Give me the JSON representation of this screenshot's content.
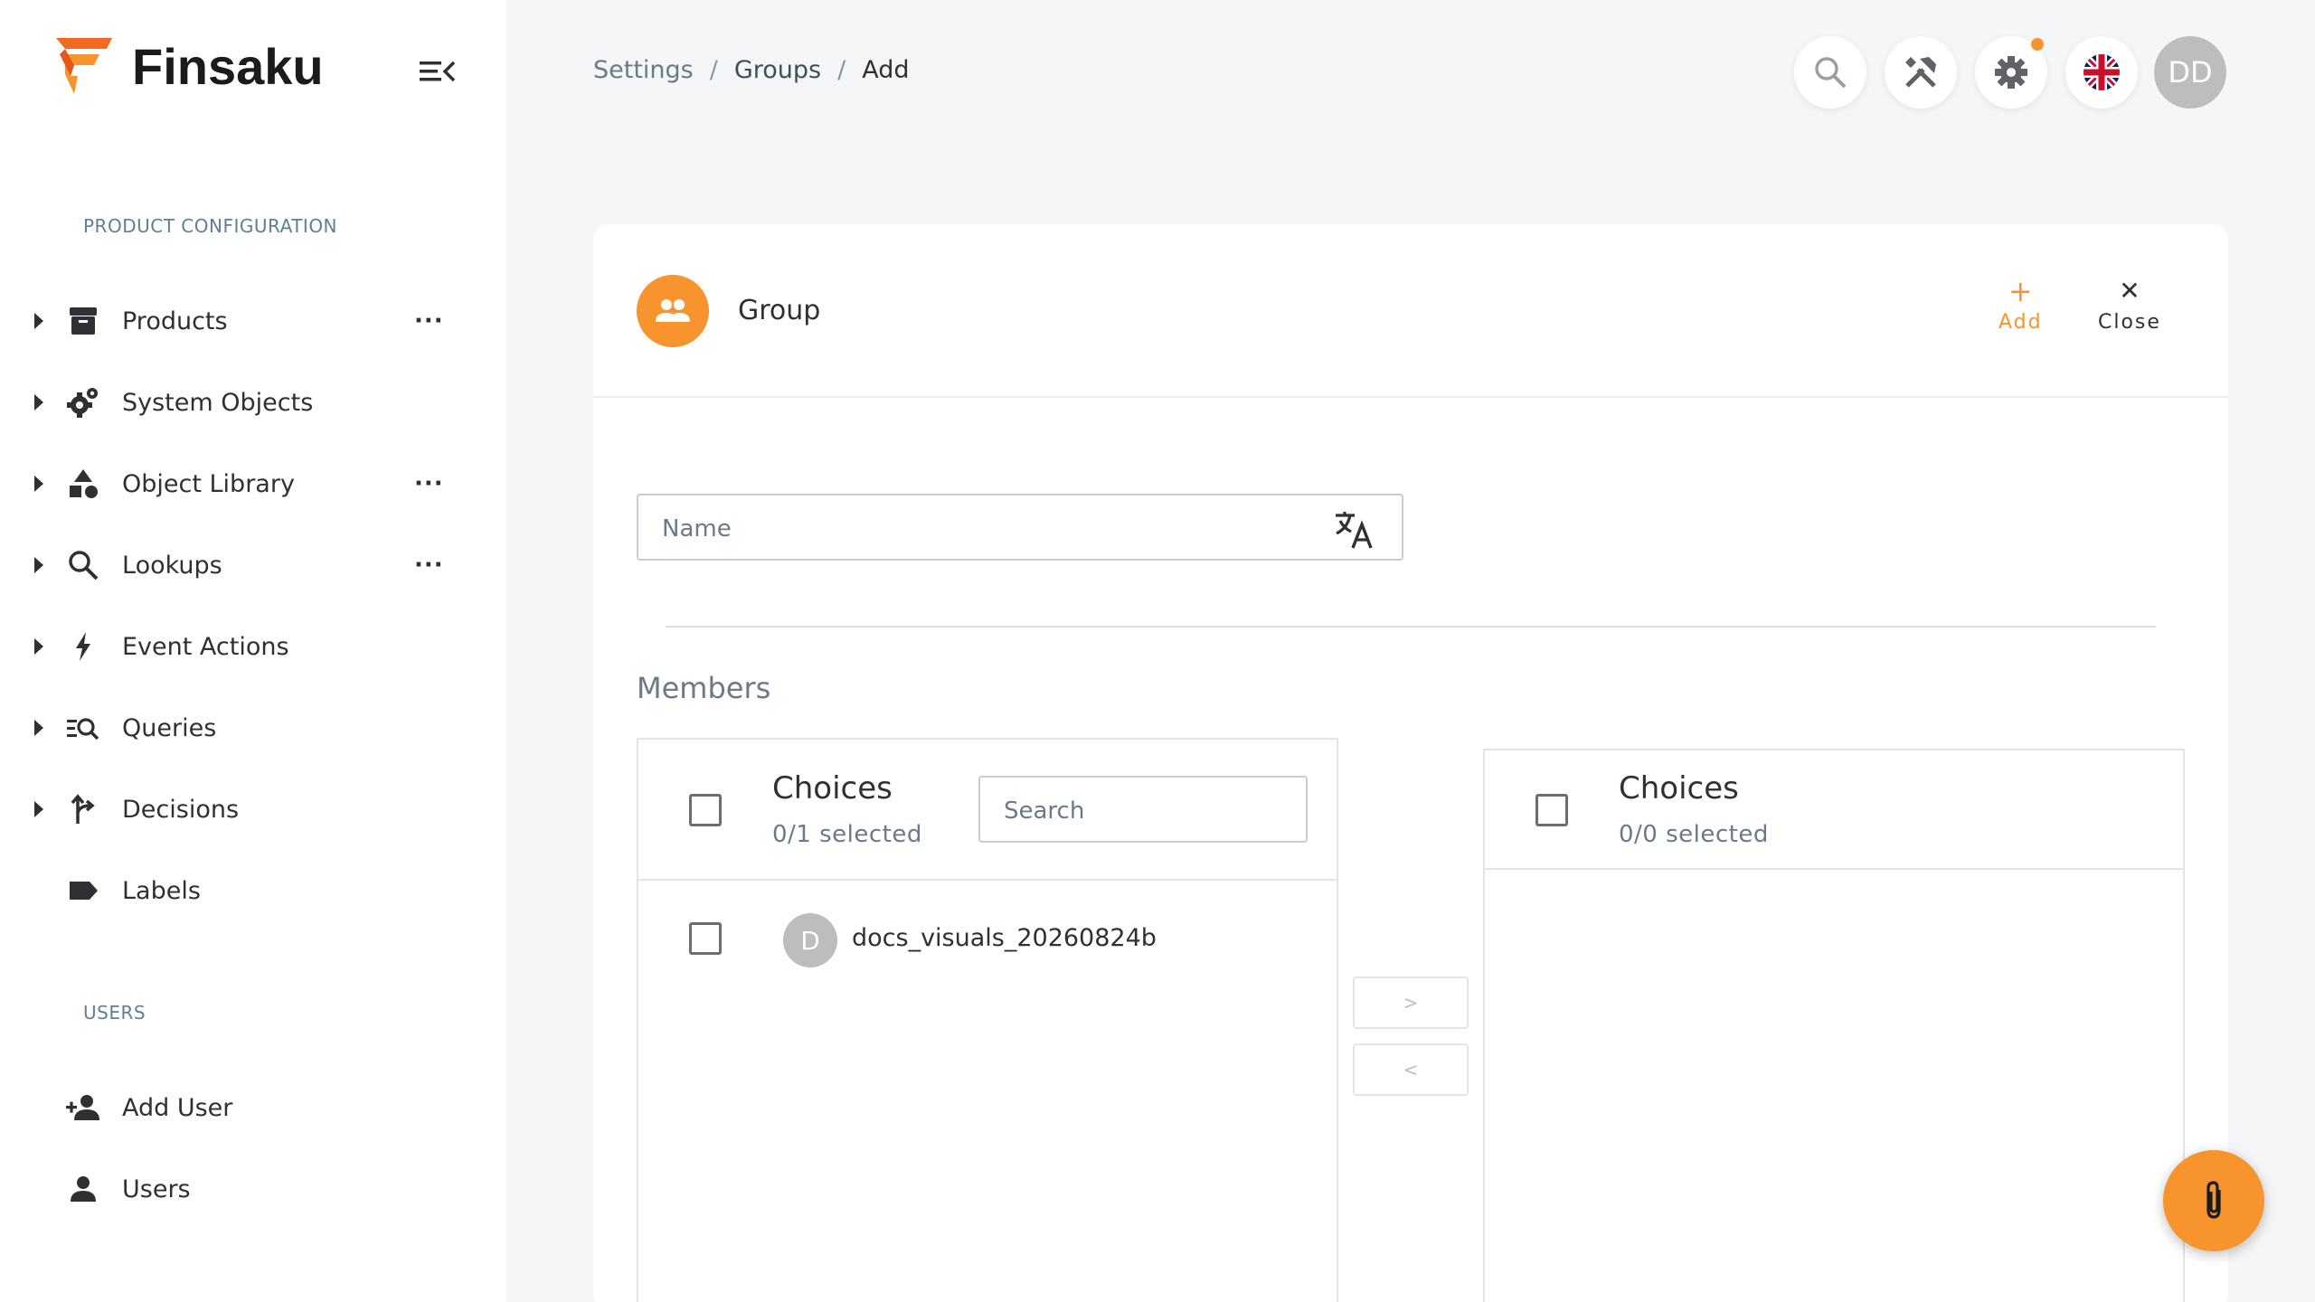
{
  "app": {
    "name": "Finsaku",
    "brand_color": "#f7942d"
  },
  "sidebar": {
    "sections": [
      {
        "label": "PRODUCT CONFIGURATION",
        "items": [
          {
            "label": "Products",
            "icon": "archive-icon",
            "has_more": true,
            "expandable": true
          },
          {
            "label": "System Objects",
            "icon": "gears-icon",
            "has_more": false,
            "expandable": true
          },
          {
            "label": "Object Library",
            "icon": "shapes-icon",
            "has_more": true,
            "expandable": true
          },
          {
            "label": "Lookups",
            "icon": "search-icon",
            "has_more": true,
            "expandable": true
          },
          {
            "label": "Event Actions",
            "icon": "lightning-icon",
            "has_more": false,
            "expandable": true
          },
          {
            "label": "Queries",
            "icon": "query-icon",
            "has_more": false,
            "expandable": true
          },
          {
            "label": "Decisions",
            "icon": "decision-icon",
            "has_more": false,
            "expandable": true
          },
          {
            "label": "Labels",
            "icon": "label-icon",
            "has_more": false,
            "expandable": false
          }
        ]
      },
      {
        "label": "USERS",
        "items": [
          {
            "label": "Add User",
            "icon": "add-user-icon"
          },
          {
            "label": "Users",
            "icon": "user-icon"
          }
        ]
      }
    ],
    "more_glyph": "···"
  },
  "breadcrumb": {
    "items": [
      "Settings",
      "Groups",
      "Add"
    ],
    "separator": "/"
  },
  "topbar": {
    "buttons": [
      "search-icon",
      "tools-icon",
      "settings-icon",
      "uk-flag-icon"
    ],
    "avatar_initials": "DD"
  },
  "card": {
    "title": "Group",
    "add_label": "Add",
    "add_symbol": "+",
    "close_label": "Close",
    "close_symbol": "✕",
    "name_placeholder": "Name",
    "members_label": "Members",
    "left_list": {
      "title": "Choices",
      "count": "0/1 selected",
      "search_placeholder": "Search",
      "items": [
        {
          "initial": "D",
          "label": "docs_visuals_20260824b"
        }
      ]
    },
    "right_list": {
      "title": "Choices",
      "count": "0/0 selected",
      "items": []
    },
    "move_right": ">",
    "move_left": "<"
  }
}
